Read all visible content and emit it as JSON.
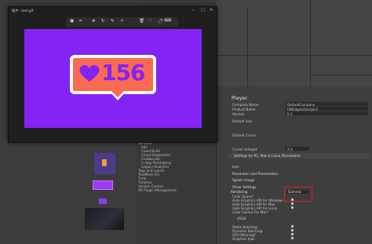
{
  "viewer": {
    "title": "图片 - test.gif",
    "edit_label": "✎ 编辑",
    "toolbar_icons": [
      "image-icon",
      "crop-icon",
      "zoom-in-icon",
      "rotate-icon",
      "markup-icon",
      "adjust-icon",
      "delete-icon",
      "favorite-icon",
      "info-icon",
      "more-icon"
    ],
    "image": {
      "likes": "156",
      "bg_color": "#8324f5",
      "badge_color": "#fb6a52"
    }
  },
  "inspector": {
    "title": "Player",
    "fields": [
      {
        "label": "Company Name",
        "value": "DefaultCompany"
      },
      {
        "label": "Product Name",
        "value": "UIWidgetsSample1"
      },
      {
        "label": "Version",
        "value": "0.1"
      },
      {
        "label": "Default Icon",
        "value": ""
      },
      {
        "label": "Default Cursor",
        "value": ""
      },
      {
        "label": "Cursor Hotspot",
        "value": "X  0"
      }
    ],
    "platform_header": "Settings for PC, Mac & Linux Standalone",
    "sections": [
      "Icon",
      "Resolution and Presentation",
      "Splash Image",
      "Other Settings"
    ],
    "rendering_label": "Rendering",
    "color_space_label": "Color Space*",
    "color_space_value": "Gamma",
    "rendering_rows": [
      "Auto Graphics API for Windows",
      "Auto Graphics API for Mac",
      "Auto Graphics API for Linux",
      "Color Gamut For Mac*",
      "sRGB"
    ],
    "lower_rows": [
      "Static Batching",
      "Dynamic Batching",
      "GPU Skinning*",
      "Graphics Jobs"
    ]
  },
  "project_tree": [
    "Cloud Diagnostics",
    "Collaborate",
    "In-App Purchasing",
    "Legacy Analytics",
    "Tags and Layers",
    "TextMesh Pro",
    "Time",
    "Timeline",
    "Version Control",
    "XR Plugin Management"
  ],
  "project_tree_top": [
    "Services",
    "Ads",
    "Cloud Build"
  ]
}
